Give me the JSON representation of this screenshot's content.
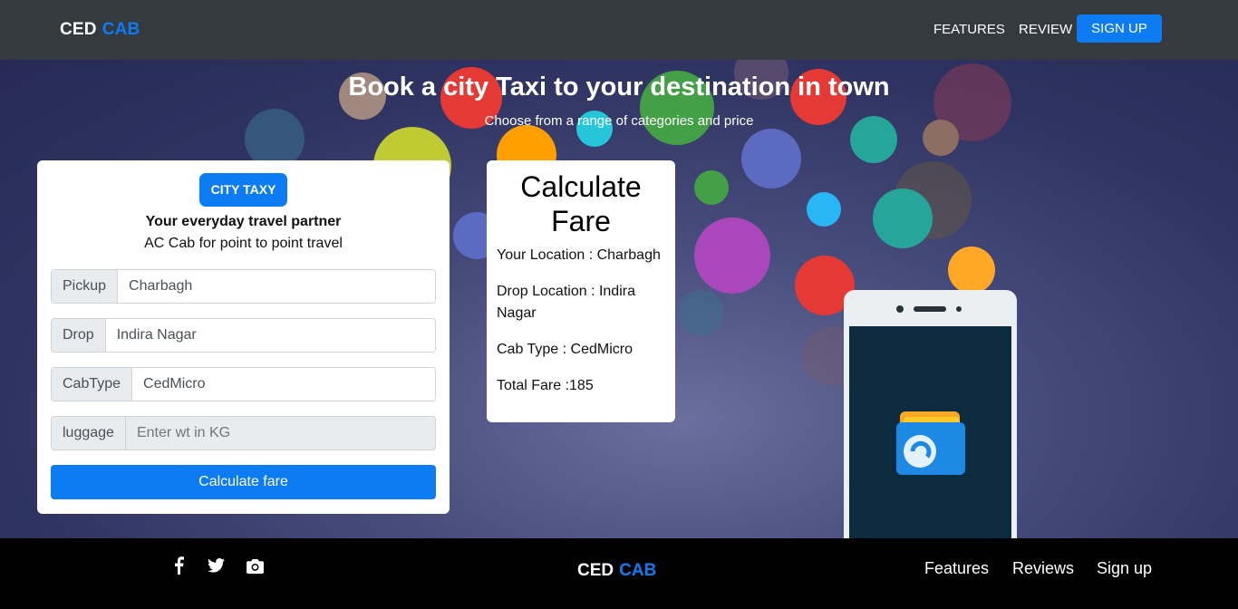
{
  "navbar": {
    "brand_part1": "CED",
    "brand_part2": "CAB",
    "links": [
      "FEATURES",
      "REVIEW"
    ],
    "signup_label": "SIGN UP"
  },
  "hero": {
    "title": "Book a city Taxi to your destination in town",
    "subtitle": "Choose from a range of categories and price"
  },
  "booking": {
    "badge": "CITY TAXY",
    "tagline": "Your everyday travel partner",
    "subtagline": "AC Cab for point to point travel",
    "fields": [
      {
        "label": "Pickup",
        "value": "Charbagh"
      },
      {
        "label": "Drop",
        "value": "Indira Nagar"
      },
      {
        "label": "CabType",
        "value": "CedMicro"
      },
      {
        "label": "luggage",
        "value": "",
        "placeholder": "Enter wt in KG"
      }
    ],
    "button_label": "Calculate fare"
  },
  "fare": {
    "title": "Calculate Fare",
    "lines": [
      "Your Location : Charbagh",
      "Drop Location : Indira Nagar",
      "Cab Type : CedMicro",
      "Total Fare :185"
    ]
  },
  "footer": {
    "social_icons": [
      "facebook-icon",
      "twitter-icon",
      "camera-icon"
    ],
    "brand_part1": "CED",
    "brand_part2": "CAB",
    "links": [
      "Features",
      "Reviews",
      "Sign up"
    ]
  },
  "colors": {
    "accent": "#0d7cf2",
    "navbar": "#343a40",
    "footer": "#000000"
  }
}
